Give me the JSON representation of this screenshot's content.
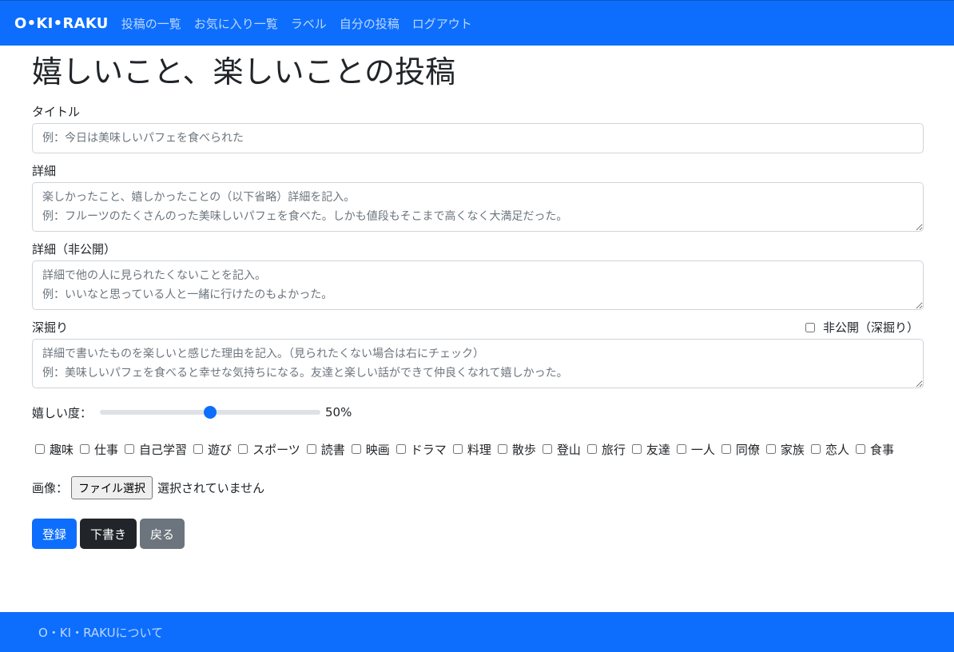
{
  "nav": {
    "brand": "O•KI•RAKU",
    "links": [
      "投稿の一覧",
      "お気に入り一覧",
      "ラベル",
      "自分の投稿",
      "ログアウト"
    ]
  },
  "page": {
    "title": "嬉しいこと、楽しいことの投稿"
  },
  "form": {
    "title_label": "タイトル",
    "title_placeholder": "例：今日は美味しいパフェを食べられた",
    "detail_label": "詳細",
    "detail_placeholder": "楽しかったこと、嬉しかったことの（以下省略）詳細を記入。\n例：フルーツのたくさんのった美味しいパフェを食べた。しかも値段もそこまで高くなく大満足だった。",
    "private_detail_label": "詳細（非公開）",
    "private_detail_placeholder": "詳細で他の人に見られたくないことを記入。\n例：いいなと思っている人と一緒に行けたのもよかった。",
    "deep_label": "深掘り",
    "deep_private_label": "非公開（深掘り）",
    "deep_placeholder": "詳細で書いたものを楽しいと感じた理由を記入。（見られたくない場合は右にチェック）\n例：美味しいパフェを食べると幸せな気持ちになる。友達と楽しい話ができて仲良くなれて嬉しかった。",
    "happiness_label": "嬉しい度：",
    "happiness_value": 50,
    "happiness_display": "50%",
    "tags": [
      "趣味",
      "仕事",
      "自己学習",
      "遊び",
      "スポーツ",
      "読書",
      "映画",
      "ドラマ",
      "料理",
      "散歩",
      "登山",
      "旅行",
      "友達",
      "一人",
      "同僚",
      "家族",
      "恋人",
      "食事"
    ],
    "image_label": "画像：",
    "file_button": "ファイル選択",
    "file_status": "選択されていません",
    "submit": "登録",
    "draft": "下書き",
    "back": "戻る"
  },
  "footer": {
    "link": "O・KI・RAKUについて"
  },
  "colors": {
    "primary": "#0d6efd",
    "dark": "#212529",
    "secondary": "#6c757d"
  }
}
